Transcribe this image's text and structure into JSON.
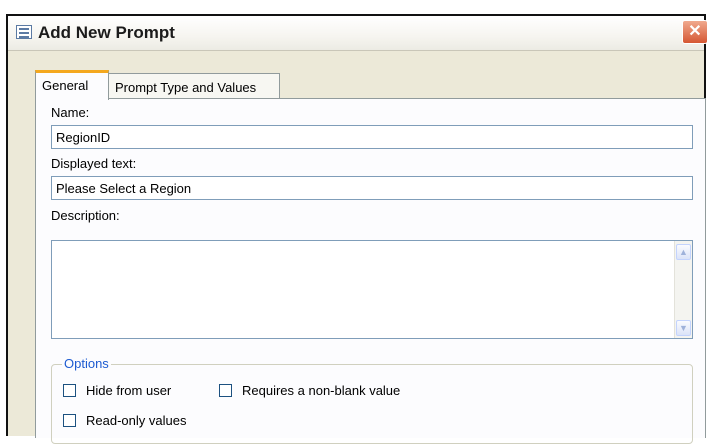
{
  "window": {
    "title": "Add New Prompt",
    "close_label": "✕"
  },
  "tabs": [
    {
      "label": "General",
      "active": true
    },
    {
      "label": "Prompt Type and Values",
      "active": false
    }
  ],
  "general": {
    "name_label": "Name:",
    "name_value": "RegionID",
    "displayed_text_label": "Displayed text:",
    "displayed_text_value": "Please Select a Region",
    "description_label": "Description:",
    "description_value": "",
    "options_legend": "Options",
    "options": [
      {
        "label": "Hide from user",
        "checked": false
      },
      {
        "label": "Requires a non-blank value",
        "checked": false
      },
      {
        "label": "Read-only values",
        "checked": false
      }
    ]
  },
  "colors": {
    "tab_accent": "#f4a81e",
    "options_legend": "#1d5bd1",
    "close_button": "#d55733"
  }
}
